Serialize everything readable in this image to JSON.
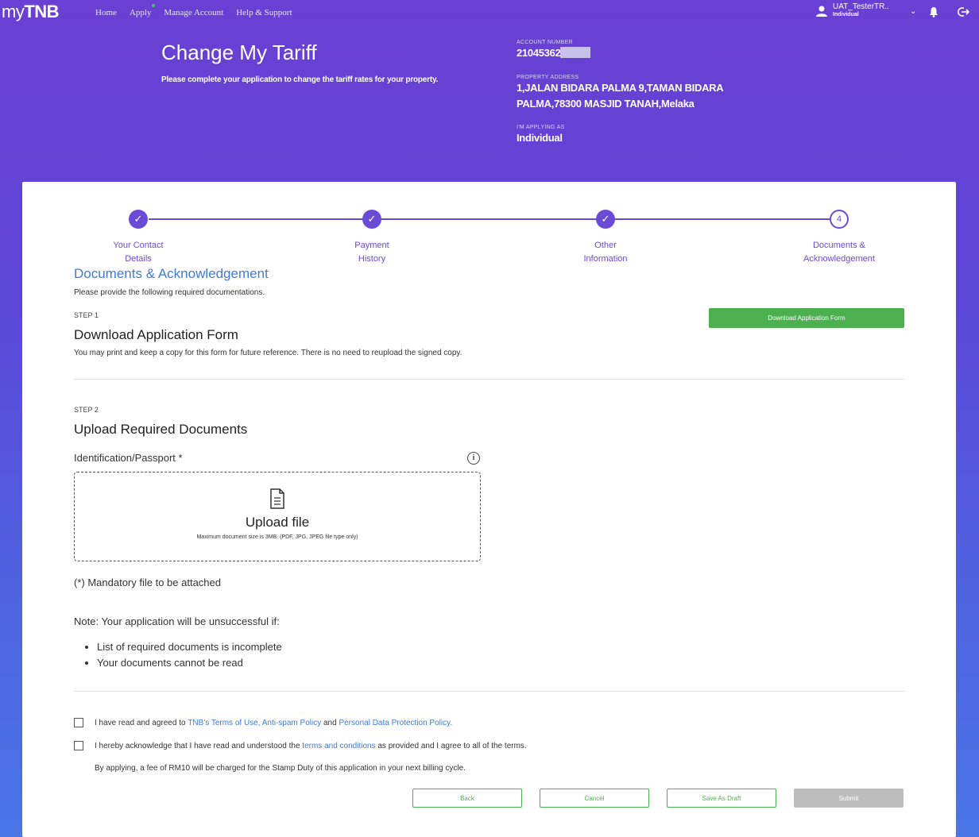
{
  "header": {
    "logo_my": "my",
    "logo_tnb": "TNB",
    "nav": [
      "Home",
      "Apply",
      "Manage Account",
      "Help & Support"
    ],
    "user_name": "UAT_TesterTR..",
    "user_role": "Individual"
  },
  "hero": {
    "title": "Change My Tariff",
    "subtitle": "Please complete your application to change the tariff rates for your property.",
    "account_label": "ACCOUNT NUMBER",
    "account_value": "21045362",
    "address_label": "PROPERTY ADDRESS",
    "address_value": "1,JALAN BIDARA PALMA 9,TAMAN BIDARA PALMA,78300 MASJID TANAH,Melaka",
    "applying_label": "I'M APPLYING AS",
    "applying_value": "Individual"
  },
  "stepper": {
    "steps": [
      {
        "label1": "Your Contact",
        "label2": "Details",
        "status": "done"
      },
      {
        "label1": "Payment",
        "label2": "History",
        "status": "done"
      },
      {
        "label1": "Other",
        "label2": "Information",
        "status": "done"
      },
      {
        "label1": "Documents &",
        "label2": "Acknowledgement",
        "status": "current",
        "number": "4"
      }
    ]
  },
  "section": {
    "title": "Documents & Acknowledgement",
    "desc": "Please provide the following required documentations."
  },
  "step1": {
    "label": "STEP 1",
    "heading": "Download Application Form",
    "note": "You may print and keep a copy for this form for future reference. There is no need to reupload the signed copy.",
    "button": "Download Application Form"
  },
  "step2": {
    "label": "STEP 2",
    "heading": "Upload Required Documents",
    "field_label": "Identification/Passport *",
    "info_glyph": "i",
    "upload_title": "Upload file",
    "upload_hint": "Maximum document size is 3MB. (PDF, JPG, JPEG file type only)",
    "mandatory": "(*) Mandatory file to be attached",
    "note": "Note: Your application will be unsuccessful if:",
    "bullets": [
      "List of required documents is incomplete",
      "Your documents cannot be read"
    ]
  },
  "agreements": {
    "terms_pre": "I have read and agreed to ",
    "terms_link1": "TNB's Terms of Use, Anti-spam Policy",
    "terms_mid": " and ",
    "terms_link2": "Personal Data Protection Policy.",
    "ack_pre": "I hereby acknowledge that I have read and understood the ",
    "ack_link": "terms and conditions",
    "ack_post": " as provided and I agree to all of the terms.",
    "fee": "By applying, a fee of RM10 will be charged for the Stamp Duty of this application in your next billing cycle."
  },
  "actions": {
    "back": "Back",
    "cancel": "Cancel",
    "save_draft": "Save As Draft",
    "submit": "Submit"
  },
  "colors": {
    "primary": "#6a4bd6",
    "link": "#3e7bd6",
    "success": "#4caf50",
    "disabled": "#bdbdbd"
  }
}
